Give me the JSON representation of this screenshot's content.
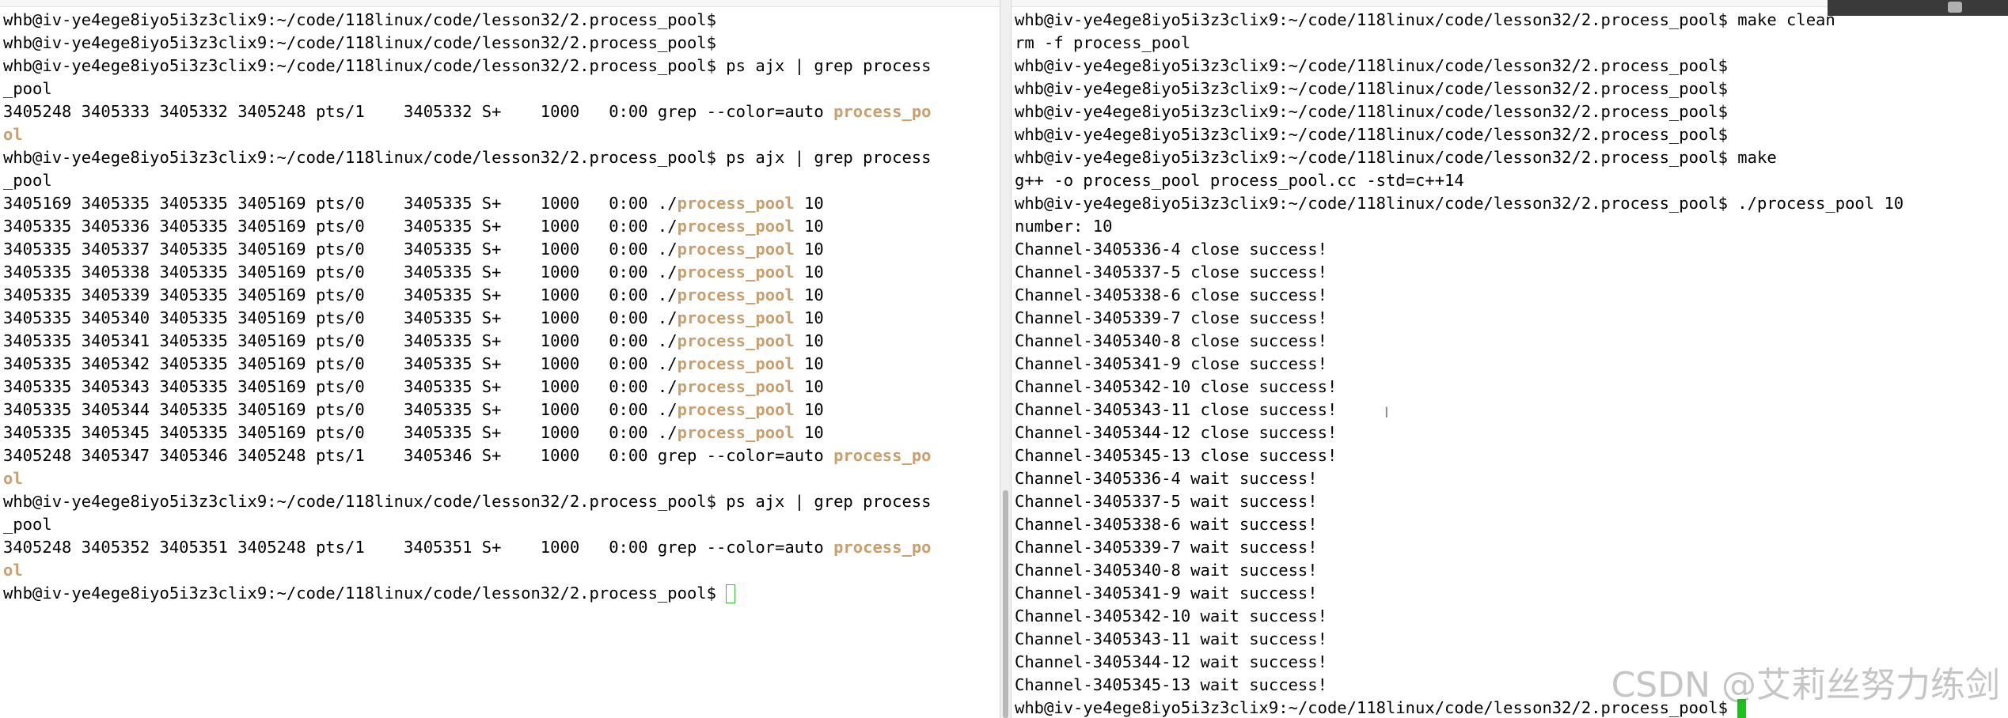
{
  "colors": {
    "background": "#ffffff",
    "text": "#000000",
    "highlight": "#c8a06e",
    "cursor": "#17c417"
  },
  "left_terminal": {
    "lines": [
      "whb@iv-ye4ege8iyo5i3z3clix9:~/code/118linux/code/lesson32/2.process_pool$",
      "whb@iv-ye4ege8iyo5i3z3clix9:~/code/118linux/code/lesson32/2.process_pool$",
      "whb@iv-ye4ege8iyo5i3z3clix9:~/code/118linux/code/lesson32/2.process_pool$ ps ajx | grep process",
      "_pool",
      {
        "before": "3405248 3405333 3405332 3405248 pts/1    3405332 S+    1000   0:00 grep --color=auto ",
        "hl": "process_po"
      },
      {
        "before": "",
        "hl": "ol"
      },
      "whb@iv-ye4ege8iyo5i3z3clix9:~/code/118linux/code/lesson32/2.process_pool$ ps ajx | grep process",
      "_pool",
      {
        "before": "3405169 3405335 3405335 3405169 pts/0    3405335 S+    1000   0:00 ./",
        "hl": "process_pool",
        "after": " 10"
      },
      {
        "before": "3405335 3405336 3405335 3405169 pts/0    3405335 S+    1000   0:00 ./",
        "hl": "process_pool",
        "after": " 10"
      },
      {
        "before": "3405335 3405337 3405335 3405169 pts/0    3405335 S+    1000   0:00 ./",
        "hl": "process_pool",
        "after": " 10"
      },
      {
        "before": "3405335 3405338 3405335 3405169 pts/0    3405335 S+    1000   0:00 ./",
        "hl": "process_pool",
        "after": " 10"
      },
      {
        "before": "3405335 3405339 3405335 3405169 pts/0    3405335 S+    1000   0:00 ./",
        "hl": "process_pool",
        "after": " 10"
      },
      {
        "before": "3405335 3405340 3405335 3405169 pts/0    3405335 S+    1000   0:00 ./",
        "hl": "process_pool",
        "after": " 10"
      },
      {
        "before": "3405335 3405341 3405335 3405169 pts/0    3405335 S+    1000   0:00 ./",
        "hl": "process_pool",
        "after": " 10"
      },
      {
        "before": "3405335 3405342 3405335 3405169 pts/0    3405335 S+    1000   0:00 ./",
        "hl": "process_pool",
        "after": " 10"
      },
      {
        "before": "3405335 3405343 3405335 3405169 pts/0    3405335 S+    1000   0:00 ./",
        "hl": "process_pool",
        "after": " 10"
      },
      {
        "before": "3405335 3405344 3405335 3405169 pts/0    3405335 S+    1000   0:00 ./",
        "hl": "process_pool",
        "after": " 10"
      },
      {
        "before": "3405335 3405345 3405335 3405169 pts/0    3405335 S+    1000   0:00 ./",
        "hl": "process_pool",
        "after": " 10"
      },
      {
        "before": "3405248 3405347 3405346 3405248 pts/1    3405346 S+    1000   0:00 grep --color=auto ",
        "hl": "process_po"
      },
      {
        "before": "",
        "hl": "ol"
      },
      "whb@iv-ye4ege8iyo5i3z3clix9:~/code/118linux/code/lesson32/2.process_pool$ ps ajx | grep process",
      "_pool",
      {
        "before": "3405248 3405352 3405351 3405248 pts/1    3405351 S+    1000   0:00 grep --color=auto ",
        "hl": "process_po"
      },
      {
        "before": "",
        "hl": "ol"
      },
      {
        "before": "whb@iv-ye4ege8iyo5i3z3clix9:~/code/118linux/code/lesson32/2.process_pool$ ",
        "cursor": "outline"
      }
    ]
  },
  "right_terminal": {
    "lines": [
      "whb@iv-ye4ege8iyo5i3z3clix9:~/code/118linux/code/lesson32/2.process_pool$ make clean",
      "rm -f process_pool",
      "whb@iv-ye4ege8iyo5i3z3clix9:~/code/118linux/code/lesson32/2.process_pool$",
      "whb@iv-ye4ege8iyo5i3z3clix9:~/code/118linux/code/lesson32/2.process_pool$",
      "whb@iv-ye4ege8iyo5i3z3clix9:~/code/118linux/code/lesson32/2.process_pool$",
      "whb@iv-ye4ege8iyo5i3z3clix9:~/code/118linux/code/lesson32/2.process_pool$",
      "whb@iv-ye4ege8iyo5i3z3clix9:~/code/118linux/code/lesson32/2.process_pool$ make",
      "g++ -o process_pool process_pool.cc -std=c++14",
      "whb@iv-ye4ege8iyo5i3z3clix9:~/code/118linux/code/lesson32/2.process_pool$ ./process_pool 10",
      "number: 10",
      "Channel-3405336-4 close success!",
      "Channel-3405337-5 close success!",
      "Channel-3405338-6 close success!",
      "Channel-3405339-7 close success!",
      "Channel-3405340-8 close success!",
      "Channel-3405341-9 close success!",
      "Channel-3405342-10 close success!",
      "Channel-3405343-11 close success!",
      "Channel-3405344-12 close success!",
      "Channel-3405345-13 close success!",
      "Channel-3405336-4 wait success!",
      "Channel-3405337-5 wait success!",
      "Channel-3405338-6 wait success!",
      "Channel-3405339-7 wait success!",
      "Channel-3405340-8 wait success!",
      "Channel-3405341-9 wait success!",
      "Channel-3405342-10 wait success!",
      "Channel-3405343-11 wait success!",
      "Channel-3405344-12 wait success!",
      "Channel-3405345-13 wait success!",
      {
        "before": "whb@iv-ye4ege8iyo5i3z3clix9:~/code/118linux/code/lesson32/2.process_pool$ ",
        "cursor": "block"
      }
    ]
  },
  "watermark": "CSDN @艾莉丝努力练剑"
}
